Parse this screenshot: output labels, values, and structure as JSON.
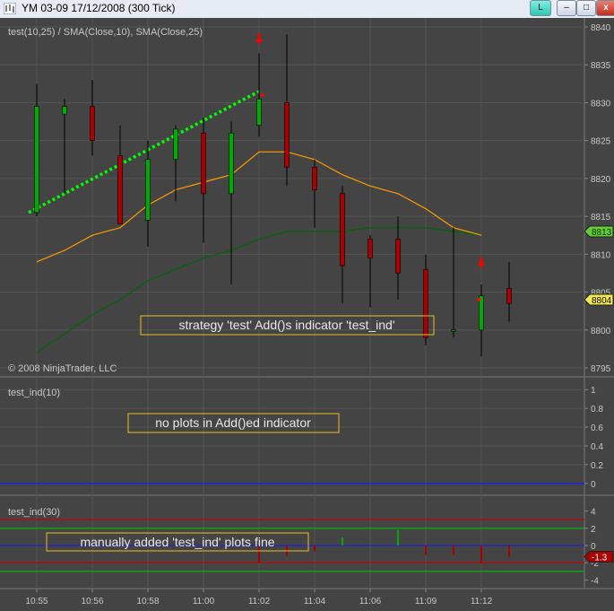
{
  "window": {
    "title": "YM 03-09  17/12/2008 (300 Tick)",
    "btn_l": "L",
    "btn_min": "–",
    "btn_max": "□",
    "btn_close": "x"
  },
  "panels": {
    "price": {
      "label": "test(10,25) / SMA(Close,10), SMA(Close,25)",
      "copyright": "© 2008 NinjaTrader, LLC",
      "annotation": "strategy 'test' Add()s indicator 'test_ind'",
      "yticks": [
        "8840",
        "8835",
        "8830",
        "8825",
        "8820",
        "8815",
        "8810",
        "8805",
        "8800",
        "8795"
      ],
      "last_price_tags": [
        "8813",
        "8804"
      ]
    },
    "ind1": {
      "label": "test_ind(10)",
      "annotation": "no plots in Add()ed indicator",
      "yticks": [
        "1",
        "0.8",
        "0.6",
        "0.4",
        "0.2",
        "0"
      ]
    },
    "ind2": {
      "label": "test_ind(30)",
      "annotation": "manually added 'test_ind' plots fine",
      "yticks": [
        "4",
        "2",
        "0",
        "-2",
        "-4"
      ],
      "last_value_tag": "-1.3"
    }
  },
  "xaxis": {
    "ticks": [
      "10:55",
      "10:56",
      "10:58",
      "11:00",
      "11:02",
      "11:04",
      "11:06",
      "11:09",
      "11:12"
    ]
  },
  "colors": {
    "bg": "#444444",
    "grid": "#555555",
    "up": "#00aa00",
    "down": "#aa0000",
    "sma10": "#ff9900",
    "sma25": "#006600",
    "trend": "#00ff00",
    "arrow": "#ff0000",
    "axis_text": "#c8c8c8"
  },
  "chart_data": [
    {
      "type": "candlestick",
      "title": "test(10,25) / SMA(Close,10), SMA(Close,25)",
      "ylim": [
        8795,
        8840
      ],
      "bars": [
        {
          "o": 8815.5,
          "h": 8832.5,
          "l": 8815,
          "c": 8829.5
        },
        {
          "o": 8828.5,
          "h": 8830.5,
          "l": 8818,
          "c": 8829.5
        },
        {
          "o": 8829.5,
          "h": 8833,
          "l": 8823,
          "c": 8825
        },
        {
          "o": 8823,
          "h": 8827,
          "l": 8817,
          "c": 8814
        },
        {
          "o": 8814.5,
          "h": 8825,
          "l": 8811,
          "c": 8822.5
        },
        {
          "o": 8822.5,
          "h": 8827,
          "l": 8817,
          "c": 8826.5
        },
        {
          "o": 8826,
          "h": 8828,
          "l": 8811.5,
          "c": 8818
        },
        {
          "o": 8818,
          "h": 8827.5,
          "l": 8806,
          "c": 8826
        },
        {
          "o": 8827,
          "h": 8836.5,
          "l": 8825.5,
          "c": 8830.5
        },
        {
          "o": 8830,
          "h": 8839,
          "l": 8819,
          "c": 8821.5
        },
        {
          "o": 8821.5,
          "h": 8822.5,
          "l": 8813.5,
          "c": 8818.5
        },
        {
          "o": 8818,
          "h": 8819,
          "l": 8803.5,
          "c": 8808.5
        },
        {
          "o": 8812,
          "h": 8812.5,
          "l": 8803,
          "c": 8809.5
        },
        {
          "o": 8812,
          "h": 8815,
          "l": 8804,
          "c": 8807.5
        },
        {
          "o": 8808,
          "h": 8810,
          "l": 8798,
          "c": 8799
        },
        {
          "o": 8800,
          "h": 8813.5,
          "l": 8799,
          "c": 8800
        },
        {
          "o": 8800,
          "h": 8806,
          "l": 8796.5,
          "c": 8804.5
        },
        {
          "o": 8805.5,
          "h": 8809,
          "l": 8801,
          "c": 8803.5
        }
      ],
      "bar_index": [
        0,
        1,
        2,
        3,
        4,
        5,
        6,
        7,
        8,
        9,
        10,
        11,
        12,
        13,
        14,
        15,
        16,
        17
      ],
      "sma10": [
        [
          0,
          8809
        ],
        [
          1,
          8810.5
        ],
        [
          2,
          8812.5
        ],
        [
          3,
          8813.5
        ],
        [
          4,
          8816.5
        ],
        [
          5,
          8818.5
        ],
        [
          6,
          8819.5
        ],
        [
          7,
          8820.5
        ],
        [
          8,
          8823.5
        ],
        [
          9,
          8823.5
        ],
        [
          10,
          8822.5
        ],
        [
          11,
          8820.5
        ],
        [
          12,
          8819
        ],
        [
          13,
          8818
        ],
        [
          14,
          8816
        ],
        [
          15,
          8813.5
        ],
        [
          16,
          8812.5
        ]
      ],
      "sma25": [
        [
          0,
          8797
        ],
        [
          1,
          8799.5
        ],
        [
          2,
          8802
        ],
        [
          3,
          8804
        ],
        [
          4,
          8806.5
        ],
        [
          5,
          8808
        ],
        [
          6,
          8809.5
        ],
        [
          7,
          8810.5
        ],
        [
          8,
          8812
        ],
        [
          9,
          8813
        ],
        [
          10,
          8813
        ],
        [
          11,
          8813
        ],
        [
          12,
          8813.5
        ],
        [
          13,
          8813.5
        ],
        [
          14,
          8813.5
        ],
        [
          15,
          8813
        ],
        [
          16,
          8812.5
        ]
      ],
      "trendline": [
        [
          -1,
          8815.5
        ],
        [
          8,
          8831.5
        ]
      ],
      "arrows": [
        {
          "bar": 8,
          "value": 8838
        },
        {
          "bar": 16,
          "value": 8808.5
        }
      ]
    },
    {
      "type": "line",
      "title": "test_ind(10)",
      "ylim": [
        -0.05,
        1.05
      ],
      "series": [
        {
          "name": "",
          "values": [
            0
          ]
        }
      ]
    },
    {
      "type": "bar",
      "title": "test_ind(30)",
      "ylim": [
        -5,
        5
      ],
      "hlines": [
        3,
        2,
        0,
        -2,
        -3
      ],
      "bars": [
        [
          11,
          0.9
        ],
        [
          13,
          1.8
        ],
        [
          14,
          -1.1
        ],
        [
          15,
          -1.1
        ],
        [
          16,
          -2.1
        ],
        [
          17,
          -1.3
        ]
      ]
    }
  ]
}
